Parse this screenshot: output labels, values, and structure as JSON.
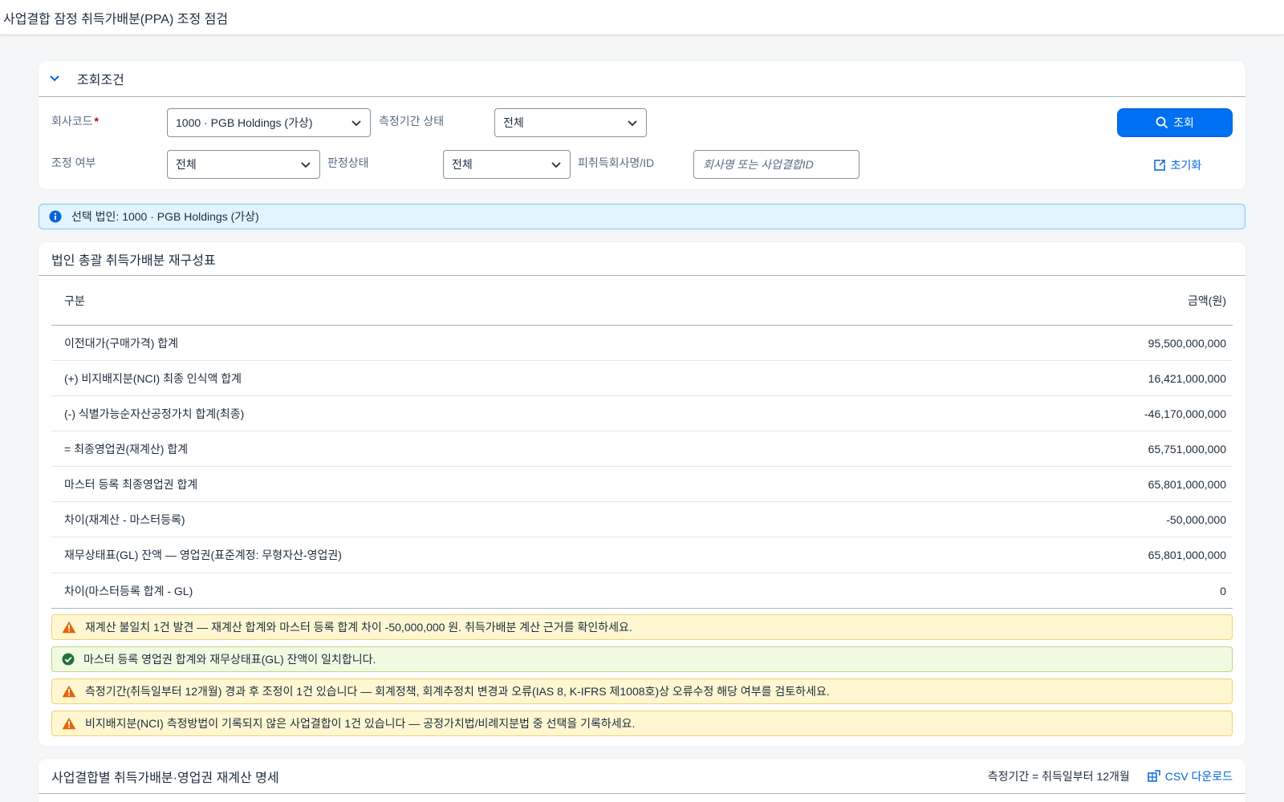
{
  "app": {
    "title": "사업결합 잠정 취득가배분(PPA) 조정 점검"
  },
  "filter": {
    "header": "조회조건",
    "company_label": "회사코드",
    "company_required": "*",
    "company_value": "1000 · PGB Holdings (가상)",
    "period_status_label": "측정기간 상태",
    "period_status_value": "전체",
    "adjust_label": "조정 여부",
    "adjust_value": "전체",
    "judge_label": "판정상태",
    "judge_value": "전체",
    "acquiree_label": "피취득회사명/ID",
    "acquiree_placeholder": "회사명 또는 사업결합ID",
    "search_button": "조회",
    "reset_button": "초기화"
  },
  "info": {
    "text": "선택 법인: 1000 · PGB Holdings (가상)"
  },
  "summary": {
    "title": "법인 총괄 취득가배분 재구성표",
    "columns": [
      "구분",
      "금액(원)"
    ],
    "rows": [
      {
        "label": "이전대가(구매가격) 합계",
        "value": "95,500,000,000"
      },
      {
        "label": "(+) 비지배지분(NCI) 최종 인식액 합계",
        "value": "16,421,000,000"
      },
      {
        "label": "(-) 식별가능순자산공정가치 합계(최종)",
        "value": "-46,170,000,000"
      },
      {
        "label": "= 최종영업권(재계산) 합계",
        "value": "65,751,000,000"
      },
      {
        "label": "마스터 등록 최종영업권 합계",
        "value": "65,801,000,000"
      },
      {
        "label": "차이(재계산 - 마스터등록)",
        "value": "-50,000,000"
      },
      {
        "label": "재무상태표(GL) 잔액 — 영업권(표준계정: 무형자산-영업권)",
        "value": "65,801,000,000"
      },
      {
        "label": "차이(마스터등록 합계 - GL)",
        "value": "0"
      }
    ],
    "messages": [
      {
        "type": "warning",
        "text": "재계산 불일치 1건 발견 — 재계산 합계와 마스터 등록 합계 차이 -50,000,000 원. 취득가배분 계산 근거를 확인하세요."
      },
      {
        "type": "success",
        "text": "마스터 등록 영업권 합계와 재무상태표(GL) 잔액이 일치합니다."
      },
      {
        "type": "warning",
        "text": "측정기간(취득일부터 12개월) 경과 후 조정이 1건 있습니다 — 회계정책, 회계추정치 변경과 오류(IAS 8, K-IFRS 제1008호)상 오류수정 해당 여부를 검토하세요."
      },
      {
        "type": "warning",
        "text": "비지배지분(NCI) 측정방법이 기록되지 않은 사업결합이 1건 있습니다 — 공정가치법/비례지분법 중 선택을 기록하세요."
      }
    ]
  },
  "detail": {
    "title": "사업결합별 취득가배분·영업권 재계산 명세",
    "note": "측정기간 = 취득일부터 12개월",
    "csv_button": "CSV 다운로드"
  },
  "colors": {
    "accent": "#0070f2",
    "warning": "#e76500",
    "success": "#256f3a",
    "info": "#0064d9"
  }
}
